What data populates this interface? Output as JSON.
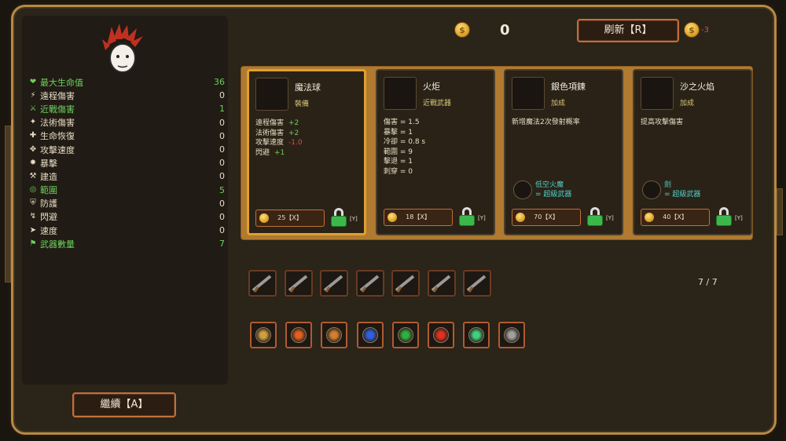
{
  "stats": [
    {
      "icon": "heart-icon",
      "label": "最大生命值",
      "value": "36",
      "color": "green"
    },
    {
      "icon": "bolt-icon",
      "label": "遠程傷害",
      "value": "0",
      "color": "white"
    },
    {
      "icon": "sword-icon",
      "label": "近戰傷害",
      "value": "1",
      "color": "green"
    },
    {
      "icon": "magic-icon",
      "label": "法術傷害",
      "value": "0",
      "color": "white"
    },
    {
      "icon": "regen-icon",
      "label": "生命恢復",
      "value": "0",
      "color": "white"
    },
    {
      "icon": "attack-speed-icon",
      "label": "攻擊速度",
      "value": "0",
      "color": "white"
    },
    {
      "icon": "crit-icon",
      "label": "暴擊",
      "value": "0",
      "color": "white"
    },
    {
      "icon": "hammer-icon",
      "label": "建造",
      "value": "0",
      "color": "white"
    },
    {
      "icon": "range-icon",
      "label": "範圍",
      "value": "5",
      "color": "green"
    },
    {
      "icon": "armor-icon",
      "label": "防護",
      "value": "0",
      "color": "white"
    },
    {
      "icon": "dodge-icon",
      "label": "閃避",
      "value": "0",
      "color": "white"
    },
    {
      "icon": "speed-icon",
      "label": "速度",
      "value": "0",
      "color": "white"
    },
    {
      "icon": "weapon-count-icon",
      "label": "武器數量",
      "value": "7",
      "color": "green"
    }
  ],
  "gold": "0",
  "refresh": {
    "label": "刷新【R】",
    "cost": "-3"
  },
  "cards": [
    {
      "name": "魔法球",
      "type": "裝備",
      "icon": "magic-orb-icon",
      "lines": [
        {
          "text": "遠程傷害",
          "mod": "+2",
          "sign": "pos"
        },
        {
          "text": "法術傷害",
          "mod": "+2",
          "sign": "pos"
        },
        {
          "text": "攻擊速度",
          "mod": "-1.0",
          "sign": "neg"
        },
        {
          "text": "閃避",
          "mod": "+1",
          "sign": "pos"
        }
      ],
      "price": "25【X】",
      "lock_key": "[Y]"
    },
    {
      "name": "火炬",
      "type": "近戰武器",
      "icon": "torch-icon",
      "lines": [
        {
          "text": "傷害 = 1.5"
        },
        {
          "text": "暴擊 = 1"
        },
        {
          "text": "冷卻 = 0.8 s"
        },
        {
          "text": "範圍 = 9"
        },
        {
          "text": "擊退 = 1"
        },
        {
          "text": "刺穿 = 0"
        }
      ],
      "price": "18【X】",
      "lock_key": "[Y]"
    },
    {
      "name": "銀色項鍊",
      "type": "加成",
      "icon": "necklace-icon",
      "lines": [
        {
          "text": "新增魔法2次發射概率"
        }
      ],
      "synergy": {
        "icon": "fire-crystal-icon",
        "line1": "低空火魔",
        "line2": "= 超級武器"
      },
      "price": "70【X】",
      "lock_key": "[Y]"
    },
    {
      "name": "沙之火焰",
      "type": "加成",
      "icon": "sand-fire-icon",
      "lines": [
        {
          "text": "提高攻擊傷害"
        }
      ],
      "synergy": {
        "icon": "sword-synergy-icon",
        "line1": "劍",
        "line2": "= 超級武器"
      },
      "price": "40【X】",
      "lock_key": "[Y]"
    }
  ],
  "weapons": [
    "revolver-icon",
    "torch-icon",
    "rifle-icon",
    "rifle-icon",
    "rifle-icon",
    "rifle-icon",
    "rifle-icon"
  ],
  "weapon_count": "7 / 7",
  "items": [
    "wand-icon",
    "fire-orb-icon",
    "bell-icon",
    "blue-gem-icon",
    "green-lizard-icon",
    "red-flame-icon",
    "green-crystal-icon",
    "orb-ring-icon"
  ],
  "continue_label": "繼續【A】",
  "colors": {
    "gold": "#e0a030",
    "green": "#6ed05c",
    "red": "#e04848",
    "cyan": "#4fd0c8"
  }
}
